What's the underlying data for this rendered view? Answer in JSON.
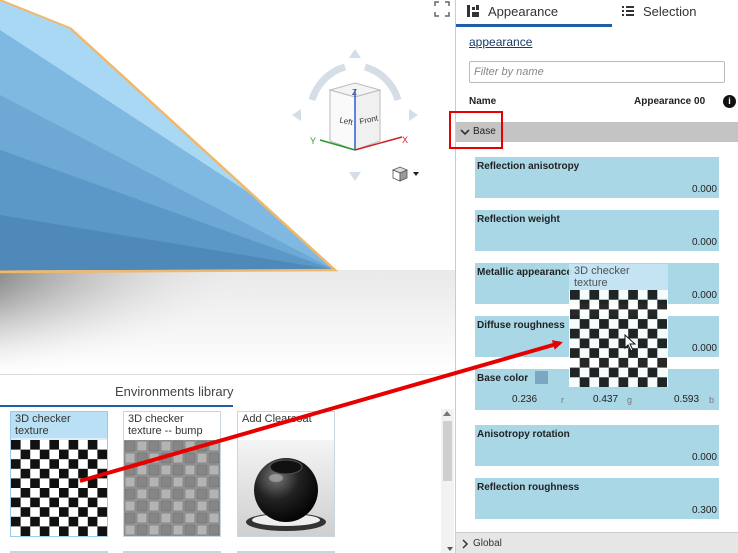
{
  "panel": {
    "tabs": [
      {
        "label": "Appearance",
        "icon": "appearance-icon",
        "active": true
      },
      {
        "label": "Selection",
        "icon": "list-icon",
        "active": false
      }
    ],
    "breadcrumb": "appearance",
    "filter_placeholder": "Filter by name",
    "name_label": "Name",
    "name_value": "Appearance 00",
    "base_section": {
      "label": "Base",
      "expanded": true
    },
    "global_section": {
      "label": "Global",
      "expanded": false
    },
    "properties": [
      {
        "label": "Reflection anisotropy",
        "value": "0.000"
      },
      {
        "label": "Reflection weight",
        "value": "0.000"
      },
      {
        "label": "Metallic appearance",
        "value": "0.000"
      },
      {
        "label": "Diffuse roughness",
        "value": "0.000"
      }
    ],
    "base_color": {
      "label": "Base color",
      "r": "0.236",
      "g": "0.437",
      "b": "0.593",
      "r_label": "r",
      "g_label": "g",
      "b_label": "b",
      "swatch": "#7aa7c2"
    },
    "properties_after": [
      {
        "label": "Anisotropy rotation",
        "value": "0.000"
      },
      {
        "label": "Reflection roughness",
        "value": "0.300"
      }
    ]
  },
  "viewcube": {
    "top": "Z",
    "left": "Left",
    "front": "Front",
    "x_axis": "X",
    "y_axis": "Y"
  },
  "library": {
    "title": "Environments library",
    "tiles": [
      {
        "label": "3D checker texture",
        "selected": true
      },
      {
        "label": "3D checker texture -- bump",
        "selected": false
      },
      {
        "label": "Add Clearcoat",
        "selected": false
      }
    ]
  },
  "drag_preview": {
    "label": "3D checker texture"
  },
  "colors": {
    "accent": "#1f5fa8",
    "property_bg": "#a9d7e5",
    "highlight": "#e60000",
    "section_bg": "#c4c4c4"
  }
}
